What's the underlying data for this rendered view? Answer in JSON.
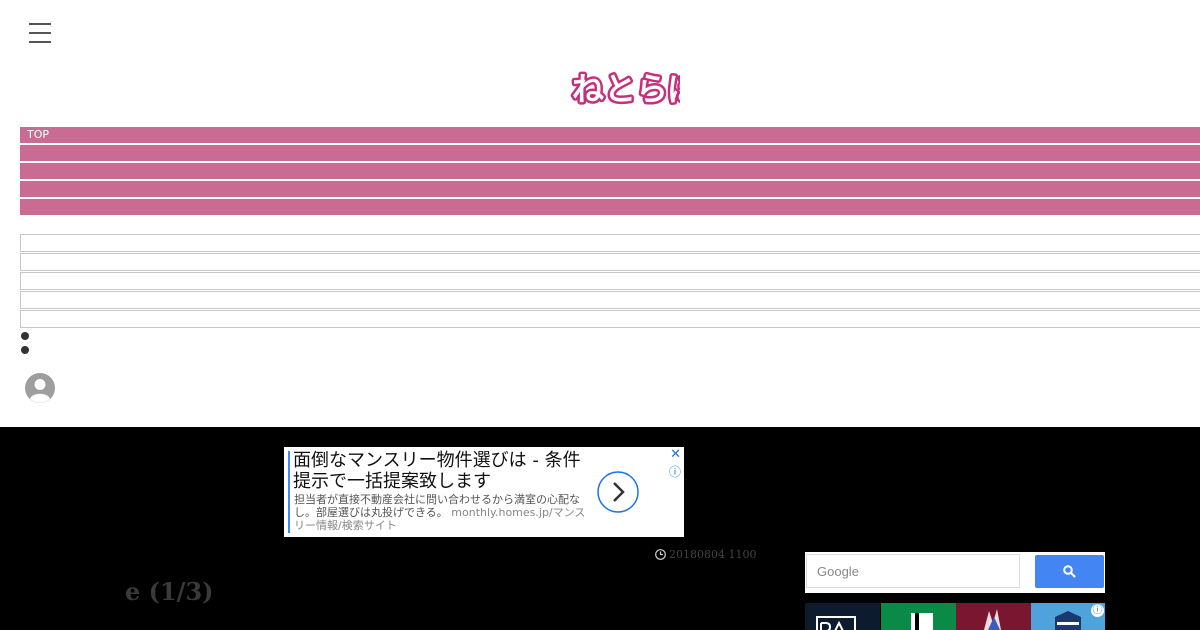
{
  "logo": {
    "text": "ねとらぼ",
    "color": "#c62f7c"
  },
  "nav": {
    "items": [
      {
        "label": "TOP"
      },
      {
        "label": ""
      },
      {
        "label": ""
      },
      {
        "label": ""
      },
      {
        "label": ""
      }
    ],
    "color": "#c96b93"
  },
  "sub_nav_rows": 5,
  "ad": {
    "headline": "面倒なマンスリー物件選びは - 条件提示で一括提案致します",
    "description": "担当者が直接不動産会社に問い合わせるから満室の心配なし。部屋選びは丸投げできる。",
    "url": "monthly.homes.jp/マンスリー情報/検索サイト",
    "close": "✕",
    "info": "ⓘ"
  },
  "article": {
    "timestamp": "20180804 1100",
    "title_fragment": "e (1/3)"
  },
  "search": {
    "placeholder": "Google"
  },
  "team_ad": {
    "tiles": [
      {
        "name": "team-tile-1",
        "color": "#0d1b2e"
      },
      {
        "name": "team-tile-2",
        "color": "#0a8a47"
      },
      {
        "name": "team-tile-3",
        "color": "#7b1630"
      },
      {
        "name": "team-tile-4",
        "color": "#4fa3dc"
      }
    ],
    "info": "ⓘ"
  },
  "colors": {
    "brand_pink": "#c96b93",
    "dark_band": "#000000",
    "search_blue": "#4485f4"
  }
}
